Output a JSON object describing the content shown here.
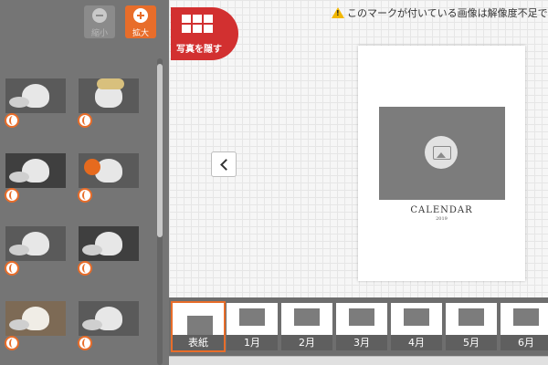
{
  "toolbar": {
    "zoom_out_label": "縮小",
    "zoom_in_label": "拡大",
    "hide_photos_label": "写真を隠す"
  },
  "notice": {
    "text": "このマークが付いている画像は解像度不足です"
  },
  "photos": [
    {
      "name": "cat-photo-1"
    },
    {
      "name": "cat-photo-2"
    },
    {
      "name": "cat-photo-3"
    },
    {
      "name": "cat-photo-4"
    },
    {
      "name": "cat-photo-5"
    },
    {
      "name": "cat-photo-6"
    },
    {
      "name": "cat-photo-7"
    },
    {
      "name": "cat-photo-8"
    }
  ],
  "page": {
    "title": "CALENDAR",
    "year": "2019"
  },
  "strip": [
    {
      "label": "表紙"
    },
    {
      "label": "1月"
    },
    {
      "label": "2月"
    },
    {
      "label": "3月"
    },
    {
      "label": "4月"
    },
    {
      "label": "5月"
    },
    {
      "label": "6月"
    }
  ],
  "colors": {
    "accent": "#e86d2a",
    "hide_button": "#d23030",
    "panel": "#757575"
  },
  "icons": {
    "zoom_out": "minus-circle-icon",
    "zoom_in": "plus-circle-icon",
    "hide_photos": "grid-icon",
    "warning": "warning-icon",
    "prev": "chevron-left-icon",
    "placeholder": "image-placeholder-icon",
    "check": "check-circle-icon"
  }
}
